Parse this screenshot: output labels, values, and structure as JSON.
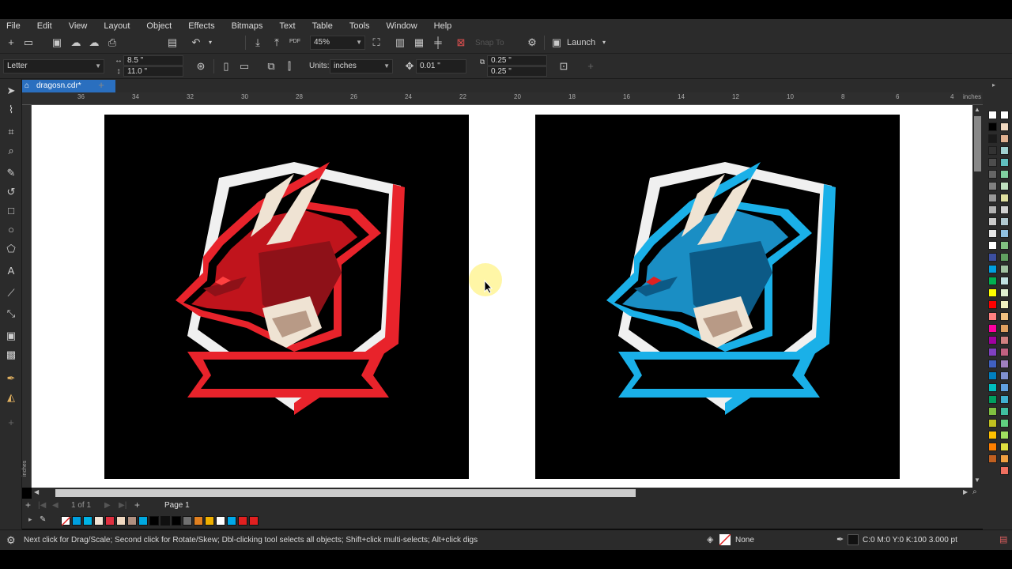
{
  "menu": [
    "File",
    "Edit",
    "View",
    "Layout",
    "Object",
    "Effects",
    "Bitmaps",
    "Text",
    "Table",
    "Tools",
    "Window",
    "Help"
  ],
  "standard_toolbar": {
    "zoom": "45%",
    "launch_label": "Launch",
    "snap_label": "Snap To",
    "pdf_label": "PDF"
  },
  "property_bar": {
    "page_size": "Letter",
    "width": "8.5 \"",
    "height": "11.0 \"",
    "units_label": "Units:",
    "units_value": "inches",
    "nudge": "0.01 \"",
    "dup_x": "0.25 \"",
    "dup_y": "0.25 \""
  },
  "document": {
    "tab_name": "dragosn.cdr*"
  },
  "ruler": {
    "h_ticks": [
      "36",
      "34",
      "32",
      "30",
      "28",
      "26",
      "24",
      "22",
      "20",
      "18",
      "16",
      "14",
      "12",
      "10",
      "8",
      "6",
      "4"
    ],
    "unit_label": "inches",
    "v_unit_label": "inches"
  },
  "page_nav": {
    "current": "1 of 1",
    "page_tab": "Page 1"
  },
  "document_palette": [
    "#ffffff",
    "#00a0e0",
    "#00b4e6",
    "#f2e4d4",
    "#e03040",
    "#f0d8c0",
    "#b09080",
    "#00a8e0",
    "#000000",
    "#101010",
    "#000000",
    "#707070",
    "#e08020",
    "#f0b000",
    "#ffffff",
    "#00a8e8",
    "#e02020"
  ],
  "color_palette": {
    "col1": [
      "#ffffff",
      "#000000",
      "#1a1a1a",
      "#333333",
      "#4d4d4d",
      "#666666",
      "#808080",
      "#999999",
      "#b3b3b3",
      "#cccccc",
      "#e6e6e6",
      "#ffffff",
      "#3c4fa0",
      "#00a0e0",
      "#00b050",
      "#ffff00",
      "#ff0000",
      "#ff8080",
      "#ff00a0",
      "#a000a0",
      "#8040c0",
      "#4060c0",
      "#0080c0",
      "#00c0c0",
      "#00a060",
      "#80c040",
      "#c0c020",
      "#ffc000",
      "#ff8000",
      "#c06020"
    ],
    "col2": [
      "#ffffff",
      "#f0d8c0",
      "#e0b090",
      "#a0d0d0",
      "#60c0c0",
      "#80d0a0",
      "#c0e0c0",
      "#e0e0a0",
      "#d0d0d0",
      "#b0c8d0",
      "#90c0e0",
      "#80c080",
      "#60a060",
      "#a0c0a0",
      "#c0e0e0",
      "#e0f0d0",
      "#f0f0c0",
      "#f0c080",
      "#e0a060",
      "#d08080",
      "#c06080",
      "#a080c0",
      "#8090d0",
      "#60a0e0",
      "#40b0d0",
      "#40c0a0",
      "#60d080",
      "#a0e060",
      "#e0e040",
      "#f0a040",
      "#f07060"
    ]
  },
  "status": {
    "message": "Next click for Drag/Scale; Second click for Rotate/Skew; Dbl-clicking tool selects all objects; Shift+click multi-selects; Alt+click digs",
    "fill": "None",
    "outline": "C:0 M:0 Y:0 K:100  3.000 pt"
  },
  "artwork": {
    "left_primary": "#e8232b",
    "left_dark": "#8e1118",
    "right_primary": "#1ab0e8",
    "right_dark": "#0c5a86",
    "shield_outline": "#f0f0f0",
    "horn": "#efe3d3"
  }
}
